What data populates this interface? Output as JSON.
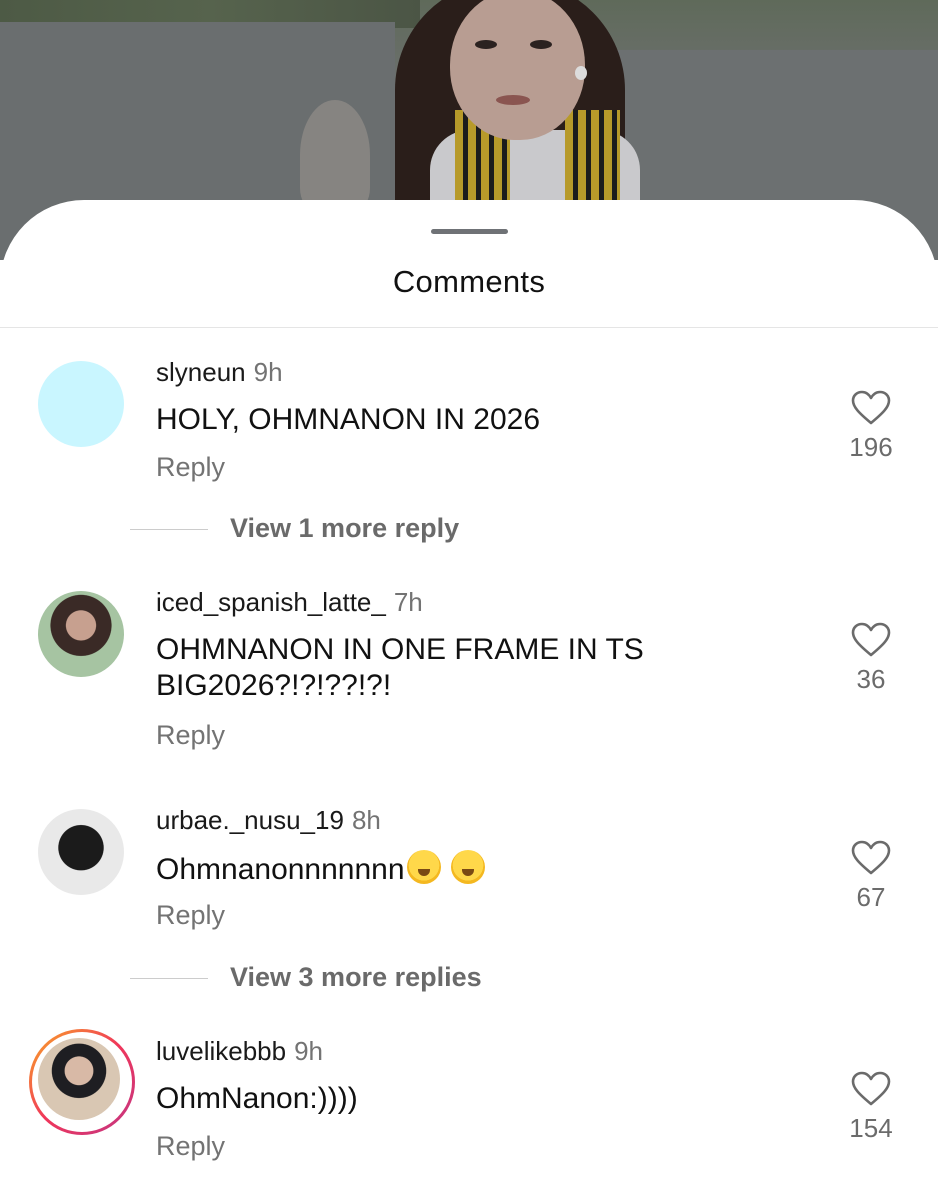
{
  "sheet": {
    "title": "Comments"
  },
  "comments": [
    {
      "username": "slyneun",
      "time": "9h",
      "text": "HOLY, OHMNANON IN 2026",
      "reply_label": "Reply",
      "likes": "196",
      "view_replies": "View 1 more reply",
      "avatar": "plain-cyan"
    },
    {
      "username": "iced_spanish_latte_",
      "time": "7h",
      "text": "OHMNANON IN ONE FRAME IN TS BIG2026?!?!??!?!",
      "reply_label": "Reply",
      "likes": "36",
      "avatar": "photo"
    },
    {
      "username": "urbae._nusu_19",
      "time": "8h",
      "text": "Ohmnanonnnnnnn",
      "emojis": [
        "loudly-crying-face",
        "loudly-crying-face"
      ],
      "reply_label": "Reply",
      "likes": "67",
      "view_replies": "View 3 more replies",
      "avatar": "photo"
    },
    {
      "username": "luvelikebbb",
      "time": "9h",
      "text": "OhmNanon:))))",
      "reply_label": "Reply",
      "likes": "154",
      "avatar": "photo-story-ring"
    }
  ],
  "colors": {
    "background": "#ffffff",
    "secondary_text": "#737373",
    "primary_text": "#111111",
    "story_ring": [
      "#f9a825",
      "#f0365a",
      "#c13584"
    ]
  }
}
